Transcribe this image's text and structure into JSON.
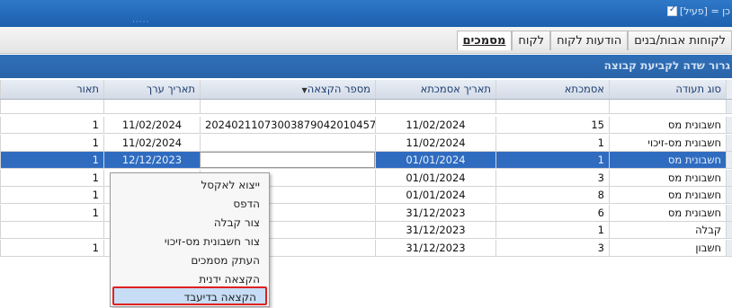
{
  "topbar": {
    "filter_text": "[פעיל] = כן"
  },
  "tabs": [
    {
      "label": "מסמכים",
      "active": true
    },
    {
      "label": "לקוח",
      "active": false
    },
    {
      "label": "הודעות לקוח",
      "active": false
    },
    {
      "label": "לקוחות אבות/בנים",
      "active": false
    }
  ],
  "groupbar": {
    "hint": "גרור שדה לקביעת קבוצה"
  },
  "grid": {
    "columns": {
      "type": "סוג תעודה",
      "asmachta": "אסמכתא",
      "asmachta_date": "תאריך אסמכתא",
      "allocation_number": "מספר הקצאה",
      "value_date": "תאריך ערך",
      "description": "תאור"
    },
    "rows": [
      {
        "type": "חשבונית מס",
        "asmachta": "15",
        "asmachta_date": "11/02/2024",
        "allocation_number": "2024021107300387904201045​7",
        "value_date": "11/02/2024",
        "description": "1"
      },
      {
        "type": "חשבונית מס-זיכוי",
        "asmachta": "1",
        "asmachta_date": "11/02/2024",
        "allocation_number": "",
        "value_date": "11/02/2024",
        "description": "1"
      },
      {
        "type": "חשבונית מס",
        "asmachta": "1",
        "asmachta_date": "01/01/2024",
        "allocation_number": "",
        "value_date": "12/12/2023",
        "description": "1"
      },
      {
        "type": "חשבונית מס",
        "asmachta": "3",
        "asmachta_date": "01/01/2024",
        "allocation_number": "",
        "value_date": "",
        "description": "1"
      },
      {
        "type": "חשבונית מס",
        "asmachta": "8",
        "asmachta_date": "01/01/2024",
        "allocation_number": "",
        "value_date": "",
        "description": "1"
      },
      {
        "type": "חשבונית מס",
        "asmachta": "6",
        "asmachta_date": "31/12/2023",
        "allocation_number": "",
        "value_date": "",
        "description": "1"
      },
      {
        "type": "קבלה",
        "asmachta": "1",
        "asmachta_date": "31/12/2023",
        "allocation_number": "",
        "value_date": "",
        "description": ""
      },
      {
        "type": "חשבון",
        "asmachta": "3",
        "asmachta_date": "31/12/2023",
        "allocation_number": "",
        "value_date": "",
        "description": "1"
      }
    ]
  },
  "context_menu": {
    "items": [
      "ייצוא לאקסל",
      "הדפס",
      "צור קבלה",
      "צור חשבונית מס-זיכוי",
      "העתק מסמכים",
      "הקצאה ידנית",
      "הקצאה בדיעבד"
    ]
  },
  "colors": {
    "accent": "#2f6cc0",
    "highlight_border": "#e02020",
    "menu_highlight": "#c7ddf5"
  }
}
